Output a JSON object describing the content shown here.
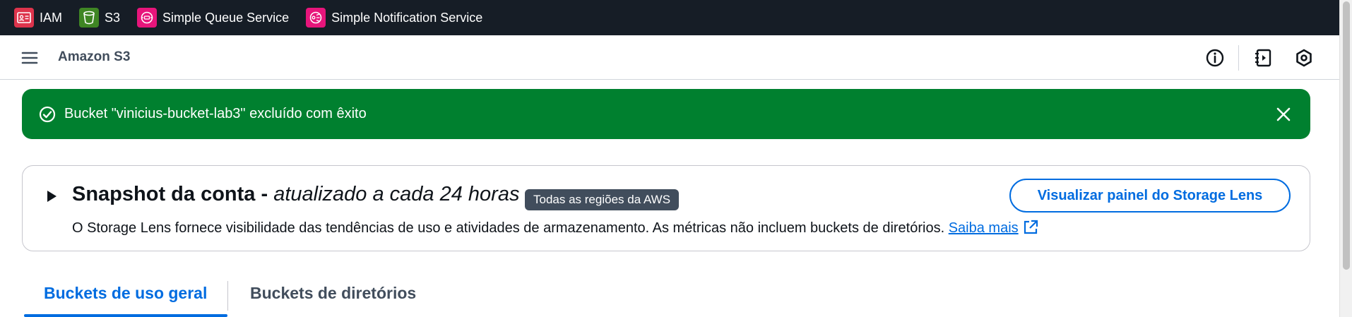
{
  "favorites": [
    {
      "label": "IAM",
      "icon": "iam-icon",
      "color": "#dd344c"
    },
    {
      "label": "S3",
      "icon": "s3-bucket-icon",
      "color": "#3f8624"
    },
    {
      "label": "Simple Queue Service",
      "icon": "sqs-icon",
      "color": "#e7157b"
    },
    {
      "label": "Simple Notification Service",
      "icon": "sns-icon",
      "color": "#e7157b"
    }
  ],
  "header": {
    "service_title": "Amazon S3"
  },
  "flash": {
    "message": "Bucket \"vinicius-bucket-lab3\" excluído com êxito",
    "color": "#00802f"
  },
  "snapshot": {
    "title_bold": "Snapshot da conta - ",
    "title_italic": "atualizado a cada 24 horas",
    "badge": "Todas as regiões da AWS",
    "description": "O Storage Lens fornece visibilidade das tendências de uso e atividades de armazenamento. As métricas não incluem buckets de diretórios.",
    "link": "Saiba mais",
    "button": "Visualizar painel do Storage Lens"
  },
  "tabs": [
    {
      "label": "Buckets de uso geral",
      "active": true
    },
    {
      "label": "Buckets de diretórios",
      "active": false
    }
  ],
  "colors": {
    "accent": "#006ce0",
    "topbar": "#161d26"
  }
}
